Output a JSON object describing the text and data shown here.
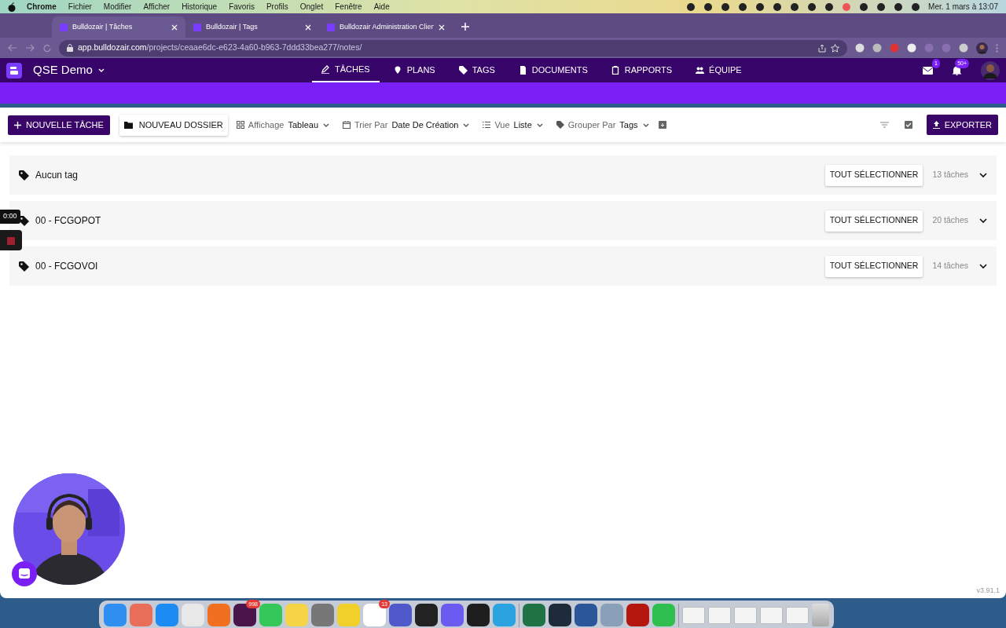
{
  "menubar": {
    "app": "Chrome",
    "items": [
      "Fichier",
      "Modifier",
      "Afficher",
      "Historique",
      "Favoris",
      "Profils",
      "Onglet",
      "Fenêtre",
      "Aide"
    ],
    "clock": "Mer. 1 mars à 13:07"
  },
  "browser": {
    "tabs": [
      {
        "title": "Bulldozair | Tâches",
        "selected": true
      },
      {
        "title": "Bulldozair | Tags",
        "selected": false
      },
      {
        "title": "Bulldozair Administration Clien",
        "selected": false
      }
    ],
    "url_host": "app.bulldozair.com",
    "url_path": "/projects/ceaae6dc-e623-4a60-b963-7ddd33bea277/notes/"
  },
  "app": {
    "project": "QSE Demo",
    "nav": [
      {
        "label": "TÂCHES",
        "kind": "pen",
        "selected": true
      },
      {
        "label": "PLANS",
        "kind": "pin",
        "selected": false
      },
      {
        "label": "TAGS",
        "kind": "tag",
        "selected": false
      },
      {
        "label": "DOCUMENTS",
        "kind": "doc",
        "selected": false
      },
      {
        "label": "RAPPORTS",
        "kind": "clipboard",
        "selected": false
      },
      {
        "label": "ÉQUIPE",
        "kind": "people",
        "selected": false
      }
    ],
    "messages_badge": "1",
    "notifications_badge": "50+"
  },
  "toolbar": {
    "new_task": "NOUVELLE TÂCHE",
    "new_folder": "NOUVEAU DOSSIER",
    "dropdowns": [
      {
        "kind": "grid",
        "label": "Affichage",
        "value": "Tableau"
      },
      {
        "kind": "calendar",
        "label": "Trier Par",
        "value": "Date De Création"
      },
      {
        "kind": "list",
        "label": "Vue",
        "value": "Liste"
      },
      {
        "kind": "tag",
        "label": "Grouper Par",
        "value": "Tags"
      }
    ],
    "export": "EXPORTER"
  },
  "groups": [
    {
      "name": "Aucun tag",
      "button": "TOUT SÉLECTIONNER",
      "count": "13 tâches"
    },
    {
      "name": "00 - FCGOPOT",
      "button": "TOUT SÉLECTIONNER",
      "count": "20 tâches"
    },
    {
      "name": "00 - FCGOVOI",
      "button": "TOUT SÉLECTIONNER",
      "count": "14 tâches"
    }
  ],
  "recording": {
    "timer": "0:00"
  },
  "version": "v3.91.1",
  "dock": [
    {
      "kind": "app"
    },
    {
      "kind": "app"
    },
    {
      "kind": "app"
    },
    {
      "kind": "app"
    },
    {
      "kind": "app"
    },
    {
      "kind": "app",
      "badge": "998"
    },
    {
      "kind": "app"
    },
    {
      "kind": "app"
    },
    {
      "kind": "app"
    },
    {
      "kind": "app"
    },
    {
      "kind": "app",
      "badge": "13"
    },
    {
      "kind": "app"
    },
    {
      "kind": "app"
    },
    {
      "kind": "app"
    },
    {
      "kind": "app"
    },
    {
      "kind": "app"
    },
    {
      "kind": "divider"
    },
    {
      "kind": "app"
    },
    {
      "kind": "app"
    },
    {
      "kind": "app"
    },
    {
      "kind": "app"
    },
    {
      "kind": "app"
    },
    {
      "kind": "app"
    },
    {
      "kind": "divider"
    },
    {
      "kind": "window"
    },
    {
      "kind": "window"
    },
    {
      "kind": "window"
    },
    {
      "kind": "window"
    },
    {
      "kind": "window"
    },
    {
      "kind": "trash"
    }
  ]
}
